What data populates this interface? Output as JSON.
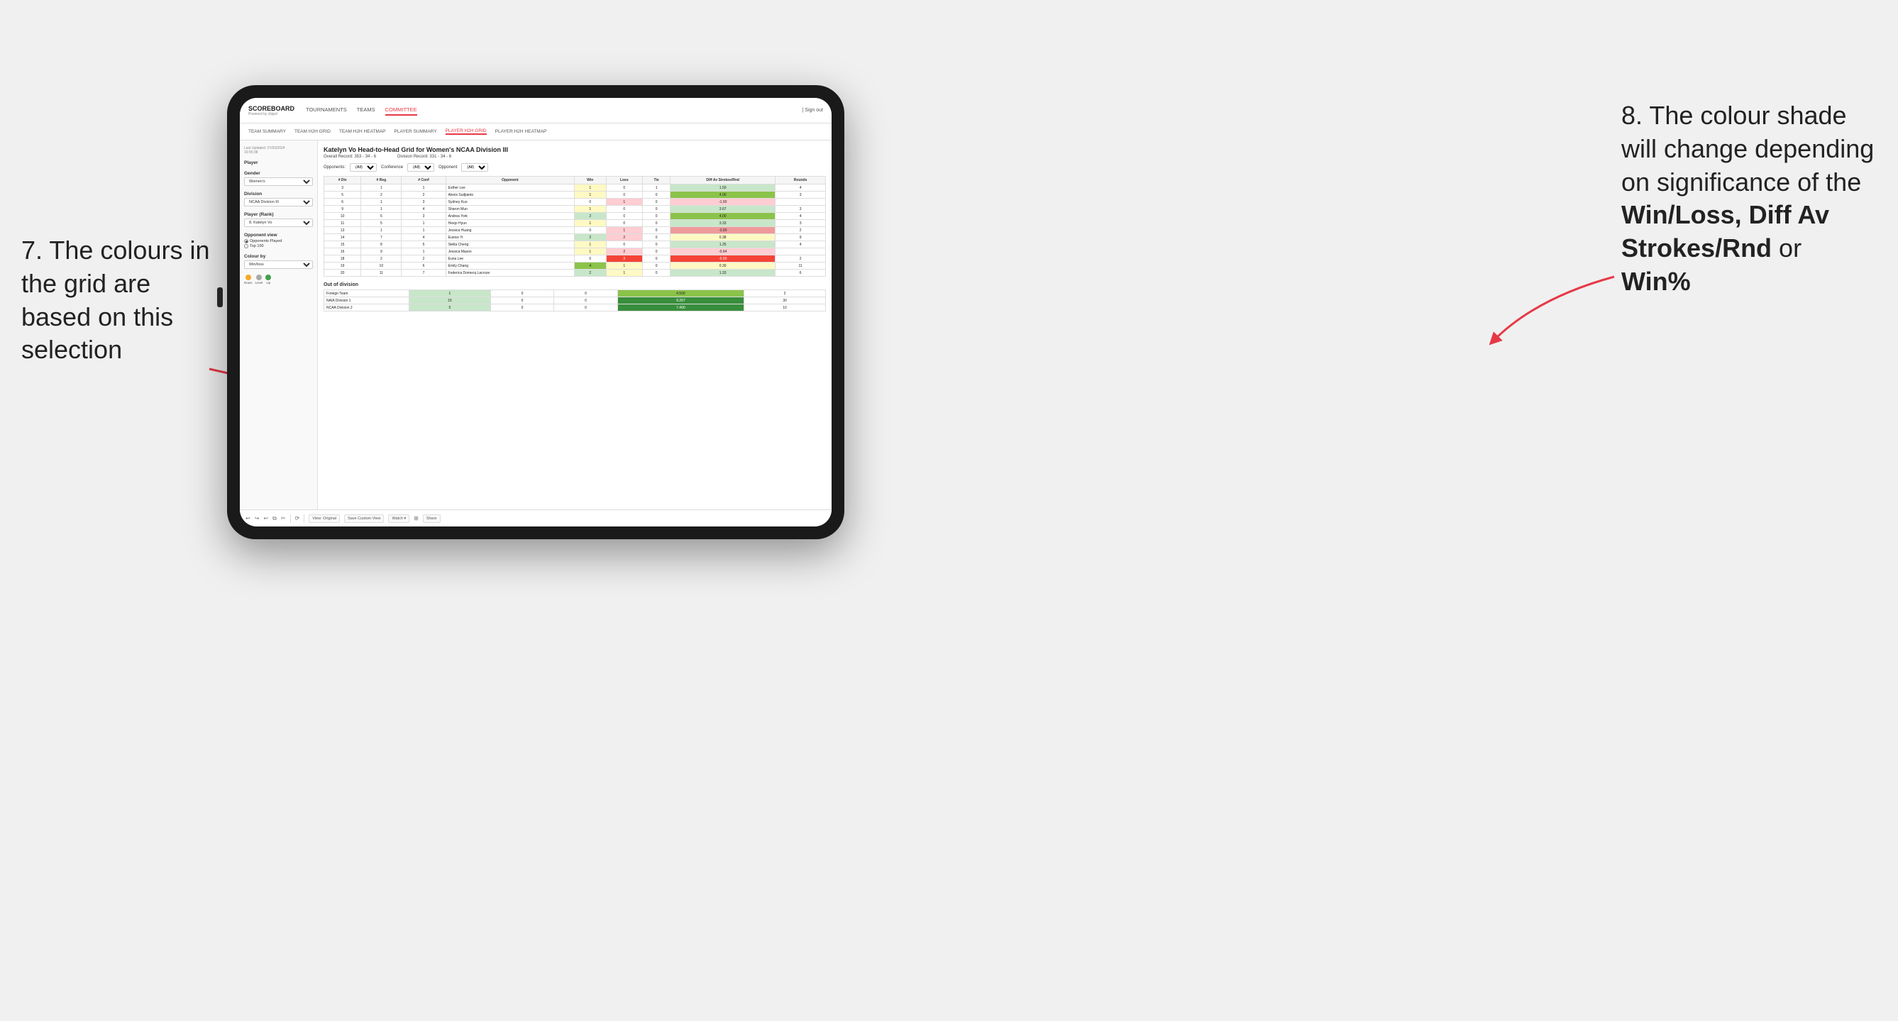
{
  "annotations": {
    "left_title": "7. The colours in the grid are based on this selection",
    "right_title": "8. The colour shade will change depending on significance of the",
    "right_bold1": "Win/Loss,",
    "right_bold2": "Diff Av Strokes/Rnd",
    "right_connector": "or",
    "right_bold3": "Win%"
  },
  "nav": {
    "logo": "SCOREBOARD",
    "logo_sub": "Powered by clippd",
    "links": [
      "TOURNAMENTS",
      "TEAMS",
      "COMMITTEE"
    ],
    "active_link": "COMMITTEE",
    "right": "| Sign out"
  },
  "sub_nav": {
    "links": [
      "TEAM SUMMARY",
      "TEAM H2H GRID",
      "TEAM H2H HEATMAP",
      "PLAYER SUMMARY",
      "PLAYER H2H GRID",
      "PLAYER H2H HEATMAP"
    ],
    "active": "PLAYER H2H GRID"
  },
  "sidebar": {
    "timestamp_label": "Last Updated: 27/03/2024",
    "timestamp_time": "16:55:38",
    "player_label": "Player",
    "gender_label": "Gender",
    "gender_value": "Women's",
    "division_label": "Division",
    "division_value": "NCAA Division III",
    "rank_label": "Player (Rank)",
    "rank_value": "8. Katelyn Vo",
    "opponent_view_label": "Opponent view",
    "radio1": "Opponents Played",
    "radio2": "Top 100",
    "colour_by_label": "Colour by",
    "colour_by_value": "Win/loss",
    "legend_down": "Down",
    "legend_level": "Level",
    "legend_up": "Up"
  },
  "grid": {
    "title": "Katelyn Vo Head-to-Head Grid for Women's NCAA Division III",
    "overall_record": "Overall Record: 353 - 34 - 6",
    "division_record": "Division Record: 331 - 34 - 6",
    "filter_opponents_label": "Opponents:",
    "filter_opponents_value": "(All)",
    "filter_conference_label": "Conference",
    "filter_conference_value": "(All)",
    "filter_opponent_label": "Opponent",
    "filter_opponent_value": "(All)",
    "columns": [
      "# Div",
      "# Reg",
      "# Conf",
      "Opponent",
      "Win",
      "Loss",
      "Tie",
      "Diff Av Strokes/Rnd",
      "Rounds"
    ],
    "rows": [
      {
        "div": "3",
        "reg": "1",
        "conf": "1",
        "name": "Esther Lee",
        "win": 1,
        "loss": 0,
        "tie": 1,
        "diff": "1.50",
        "rounds": 4,
        "win_color": "yellow",
        "loss_color": "neutral",
        "tie_color": "neutral",
        "diff_color": "green-light"
      },
      {
        "div": "5",
        "reg": "2",
        "conf": "2",
        "name": "Alexis Sudjianto",
        "win": 1,
        "loss": 0,
        "tie": 0,
        "diff": "4.00",
        "rounds": 3,
        "win_color": "yellow",
        "loss_color": "neutral",
        "tie_color": "neutral",
        "diff_color": "green-mid"
      },
      {
        "div": "6",
        "reg": "1",
        "conf": "3",
        "name": "Sydney Kuo",
        "win": 0,
        "loss": 1,
        "tie": 0,
        "diff": "-1.00",
        "rounds": "",
        "win_color": "neutral",
        "loss_color": "red-light",
        "tie_color": "neutral",
        "diff_color": "red-light"
      },
      {
        "div": "9",
        "reg": "1",
        "conf": "4",
        "name": "Sharon Mun",
        "win": 1,
        "loss": 0,
        "tie": 0,
        "diff": "3.67",
        "rounds": 3,
        "win_color": "yellow",
        "loss_color": "neutral",
        "tie_color": "neutral",
        "diff_color": "green-light"
      },
      {
        "div": "10",
        "reg": "6",
        "conf": "3",
        "name": "Andrea York",
        "win": 2,
        "loss": 0,
        "tie": 0,
        "diff": "4.00",
        "rounds": 4,
        "win_color": "green-light",
        "loss_color": "neutral",
        "tie_color": "neutral",
        "diff_color": "green-mid"
      },
      {
        "div": "11",
        "reg": "5",
        "conf": "1",
        "name": "Heejo Hyun",
        "win": 1,
        "loss": 0,
        "tie": 0,
        "diff": "3.33",
        "rounds": 3,
        "win_color": "yellow",
        "loss_color": "neutral",
        "tie_color": "neutral",
        "diff_color": "green-light"
      },
      {
        "div": "13",
        "reg": "1",
        "conf": "1",
        "name": "Jessica Huang",
        "win": 0,
        "loss": 1,
        "tie": 0,
        "diff": "-3.00",
        "rounds": 2,
        "win_color": "neutral",
        "loss_color": "red-light",
        "tie_color": "neutral",
        "diff_color": "red-mid"
      },
      {
        "div": "14",
        "reg": "7",
        "conf": "4",
        "name": "Eunice Yi",
        "win": 2,
        "loss": 2,
        "tie": 0,
        "diff": "0.38",
        "rounds": 9,
        "win_color": "green-light",
        "loss_color": "red-light",
        "tie_color": "neutral",
        "diff_color": "yellow"
      },
      {
        "div": "15",
        "reg": "8",
        "conf": "5",
        "name": "Stella Cheng",
        "win": 1,
        "loss": 0,
        "tie": 0,
        "diff": "1.25",
        "rounds": 4,
        "win_color": "yellow",
        "loss_color": "neutral",
        "tie_color": "neutral",
        "diff_color": "green-light"
      },
      {
        "div": "16",
        "reg": "9",
        "conf": "1",
        "name": "Jessica Mason",
        "win": 1,
        "loss": 2,
        "tie": 0,
        "diff": "-0.94",
        "rounds": "",
        "win_color": "yellow",
        "loss_color": "red-light",
        "tie_color": "neutral",
        "diff_color": "red-light"
      },
      {
        "div": "18",
        "reg": "2",
        "conf": "2",
        "name": "Euna Lee",
        "win": 0,
        "loss": 3,
        "tie": 0,
        "diff": "-5.00",
        "rounds": 2,
        "win_color": "neutral",
        "loss_color": "red-dark",
        "tie_color": "neutral",
        "diff_color": "red-dark"
      },
      {
        "div": "19",
        "reg": "10",
        "conf": "6",
        "name": "Emily Chang",
        "win": 4,
        "loss": 1,
        "tie": 0,
        "diff": "0.30",
        "rounds": 11,
        "win_color": "green-mid",
        "loss_color": "yellow",
        "tie_color": "neutral",
        "diff_color": "yellow"
      },
      {
        "div": "20",
        "reg": "11",
        "conf": "7",
        "name": "Federica Domecq Lacroze",
        "win": 2,
        "loss": 1,
        "tie": 0,
        "diff": "1.33",
        "rounds": 6,
        "win_color": "green-light",
        "loss_color": "yellow",
        "tie_color": "neutral",
        "diff_color": "green-light"
      }
    ],
    "out_of_division_label": "Out of division",
    "out_of_division_rows": [
      {
        "name": "Foreign Team",
        "win": 1,
        "loss": 0,
        "tie": 0,
        "diff": "4.500",
        "rounds": 2,
        "diff_color": "green-mid"
      },
      {
        "name": "NAIA Division 1",
        "win": 15,
        "loss": 0,
        "tie": 0,
        "diff": "9.267",
        "rounds": 30,
        "diff_color": "green-dark"
      },
      {
        "name": "NCAA Division 2",
        "win": 5,
        "loss": 0,
        "tie": 0,
        "diff": "7.400",
        "rounds": 10,
        "diff_color": "green-dark"
      }
    ]
  },
  "toolbar": {
    "view_original": "View: Original",
    "save_custom": "Save Custom View",
    "watch": "Watch ▾",
    "share": "Share"
  }
}
